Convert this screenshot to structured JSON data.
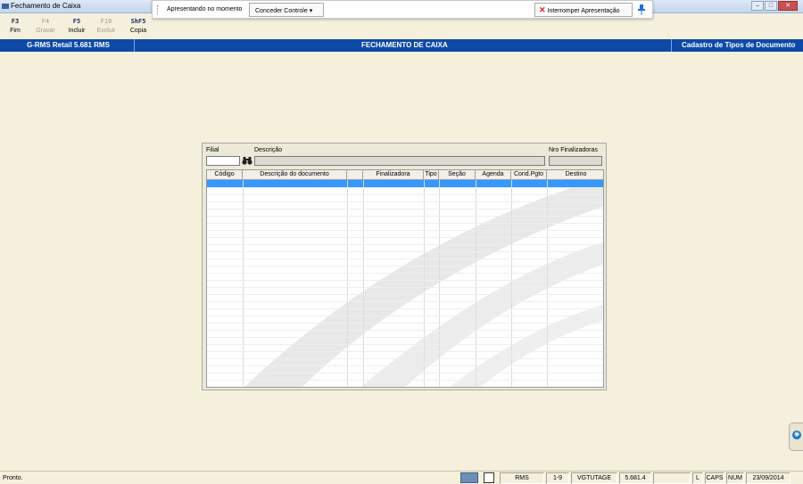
{
  "window": {
    "title": "Fechamento de Caixa",
    "controls": [
      "minimize",
      "maximize",
      "close"
    ]
  },
  "presentation": {
    "label": "Apresentando no momento",
    "grant_control": "Conceder Controle",
    "grant_arrow": "▾",
    "stop_icon": "✕",
    "stop": "Interromper Apresentação",
    "pin_icon": "🖈"
  },
  "toolbar": {
    "items": [
      {
        "key": "F3",
        "label": "Fim",
        "enabled": true
      },
      {
        "key": "F4",
        "label": "Gravar",
        "enabled": false
      },
      {
        "key": "F5",
        "label": "Incluir",
        "enabled": true
      },
      {
        "key": "F10",
        "label": "Excluir",
        "enabled": false
      },
      {
        "key": "ShF5",
        "label": "Copia",
        "enabled": true
      }
    ]
  },
  "banner": {
    "left": "G-RMS Retail 5.681 RMS",
    "center": "FECHAMENTO DE CAIXA",
    "right": "Cadastro de Tipos de Documento"
  },
  "form": {
    "filial_label": "Filial",
    "filial_value": "",
    "descricao_label": "Descrição",
    "descricao_value": "",
    "nro_label": "Nro Finalizadoras",
    "nro_value": "",
    "search_icon": "binoculars"
  },
  "grid": {
    "columns": [
      "Código",
      "Descrição do documento",
      "",
      "Finalizadora",
      "Tipo",
      "Seção",
      "Agenda",
      "Cond.Pgto",
      "Destino"
    ],
    "rows": []
  },
  "statusbar": {
    "status_text": "Pronto.",
    "panes": [
      "RMS",
      "1-9",
      "VGTUTAGE",
      "5.681.4",
      "",
      "L",
      "CAPS",
      "NUM",
      "23/09/2014"
    ]
  },
  "colors": {
    "banner": "#0d4aa8",
    "selection": "#3399ff",
    "background": "#f5f0dc"
  }
}
